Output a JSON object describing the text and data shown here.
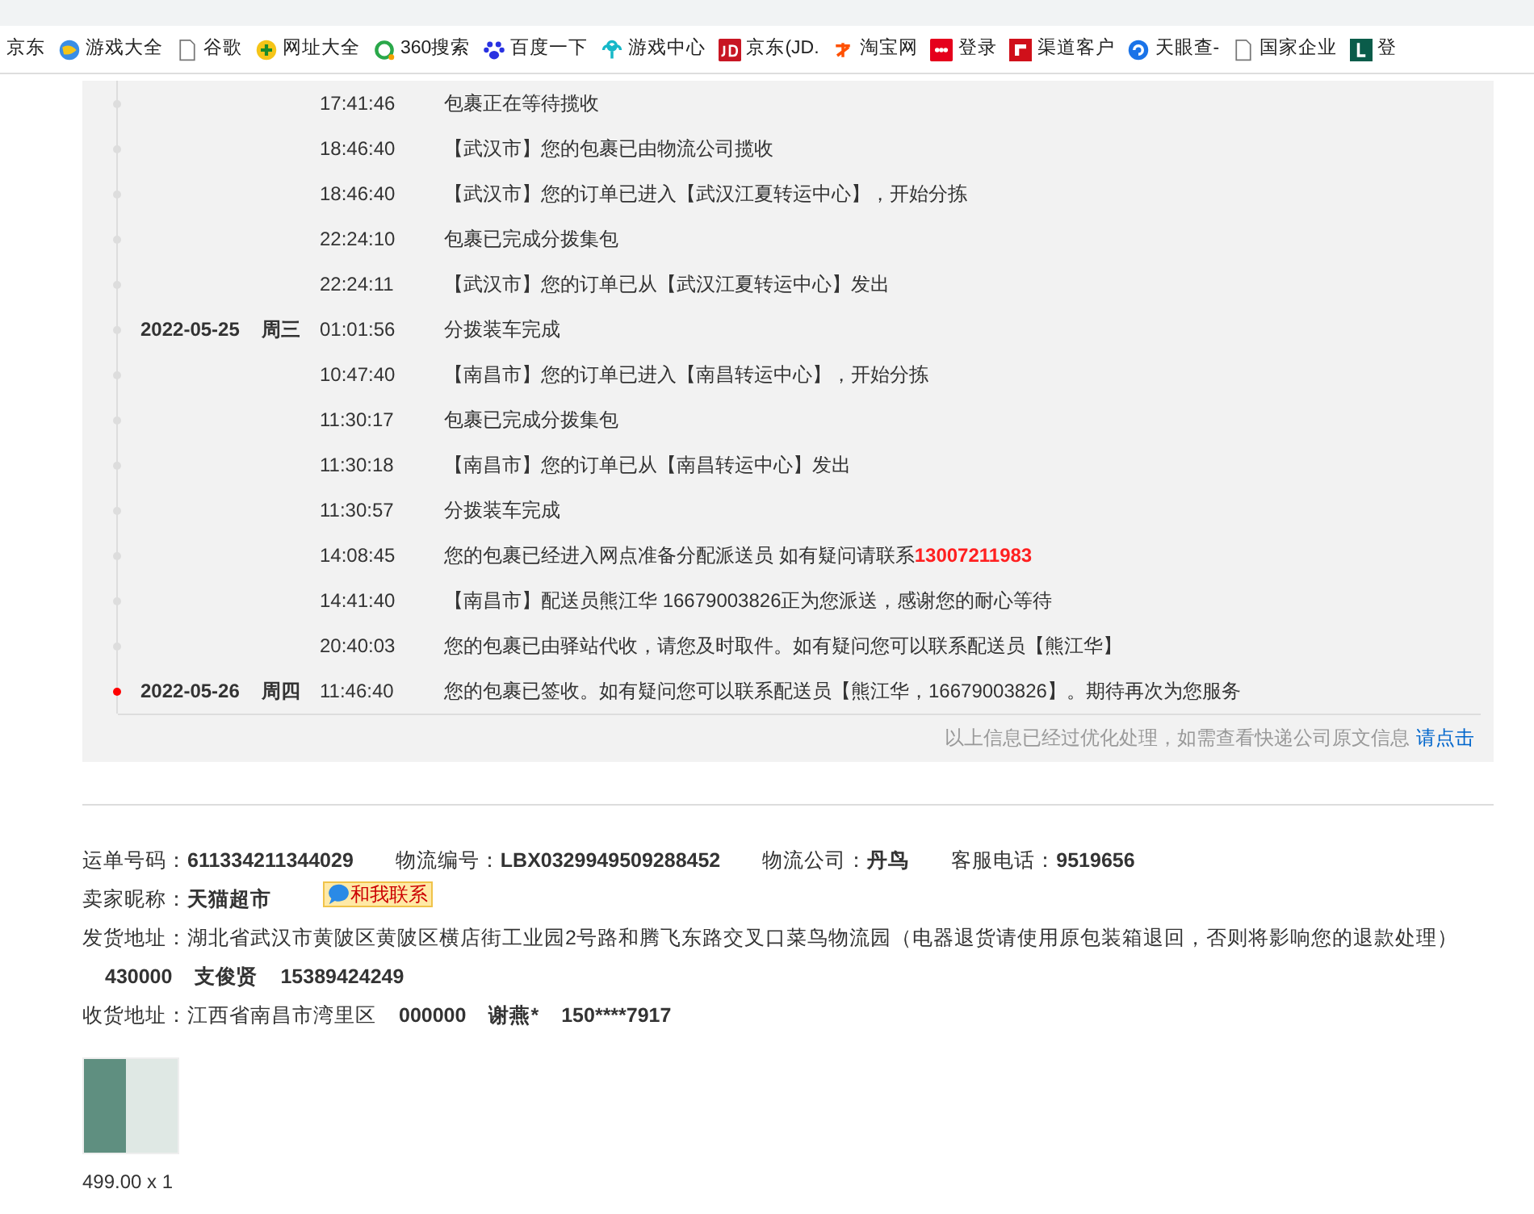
{
  "bookmarks": [
    {
      "label": "京东"
    },
    {
      "label": "游戏大全"
    },
    {
      "label": "谷歌"
    },
    {
      "label": "网址大全"
    },
    {
      "label": "360搜索"
    },
    {
      "label": "百度一下"
    },
    {
      "label": "游戏中心"
    },
    {
      "label": "京东(JD."
    },
    {
      "label": "淘宝网"
    },
    {
      "label": "登录"
    },
    {
      "label": "渠道客户"
    },
    {
      "label": "天眼查-"
    },
    {
      "label": "国家企业"
    },
    {
      "label": "登"
    }
  ],
  "timeline": [
    {
      "time": "17:41:46",
      "text": "包裹正在等待揽收",
      "current": false
    },
    {
      "time": "18:46:40",
      "text": "【武汉市】您的包裹已由物流公司揽收",
      "current": false
    },
    {
      "time": "18:46:40",
      "text": "【武汉市】您的订单已进入【武汉江夏转运中心】，开始分拣",
      "current": false
    },
    {
      "time": "22:24:10",
      "text": "包裹已完成分拨集包",
      "current": false
    },
    {
      "time": "22:24:11",
      "text": "【武汉市】您的订单已从【武汉江夏转运中心】发出",
      "current": false
    },
    {
      "date": "2022-05-25",
      "weekday": "周三",
      "time": "01:01:56",
      "text": "分拨装车完成",
      "current": false
    },
    {
      "time": "10:47:40",
      "text": "【南昌市】您的订单已进入【南昌转运中心】，开始分拣",
      "current": false
    },
    {
      "time": "11:30:17",
      "text": "包裹已完成分拨集包",
      "current": false
    },
    {
      "time": "11:30:18",
      "text": "【南昌市】您的订单已从【南昌转运中心】发出",
      "current": false
    },
    {
      "time": "11:30:57",
      "text": "分拨装车完成",
      "current": false
    },
    {
      "time": "14:08:45",
      "text": "您的包裹已经进入网点准备分配派送员 如有疑问请联系**13007211983**",
      "current": false
    },
    {
      "time": "14:41:40",
      "text": "【南昌市】配送员熊江华 16679003826正为您派送，感谢您的耐心等待",
      "current": false
    },
    {
      "time": "20:40:03",
      "text": "您的包裹已由驿站代收，请您及时取件。如有疑问您可以联系配送员【熊江华】",
      "current": false
    },
    {
      "date": "2022-05-26",
      "weekday": "周四",
      "time": "11:46:40",
      "text": "您的包裹已签收。如有疑问您可以联系配送员【熊江华，16679003826】。期待再次为您服务",
      "current": true
    }
  ],
  "notice": {
    "text": "以上信息已经过优化处理，如需查看快递公司原文信息",
    "link": "请点击"
  },
  "info": {
    "waybill": "运单号码：**611334211344029**",
    "logistics_no": "物流编号：**LBX0329949509288452**",
    "company": "物流公司：**丹鸟**",
    "hotline": "客服电话：**9519656**",
    "seller": "卖家昵称：**天猫超市**",
    "contact": "和我联系",
    "sender": {
      "address": "发货地址：湖北省武汉市黄陂区黄陂区横店街工业园2号路和腾飞东路交叉口菜鸟物流园（电器退货请使用原包装箱退回，否则将影响您的退款处理）",
      "postcode": "430000",
      "name": "支俊贤",
      "phone": "15389424249"
    },
    "receiver": {
      "address": "收货地址：江西省南昌市湾里区",
      "postcode": "000000",
      "name": "谢燕*",
      "phone": "150****7917"
    }
  },
  "product": {
    "price": "499.00 x 1"
  }
}
